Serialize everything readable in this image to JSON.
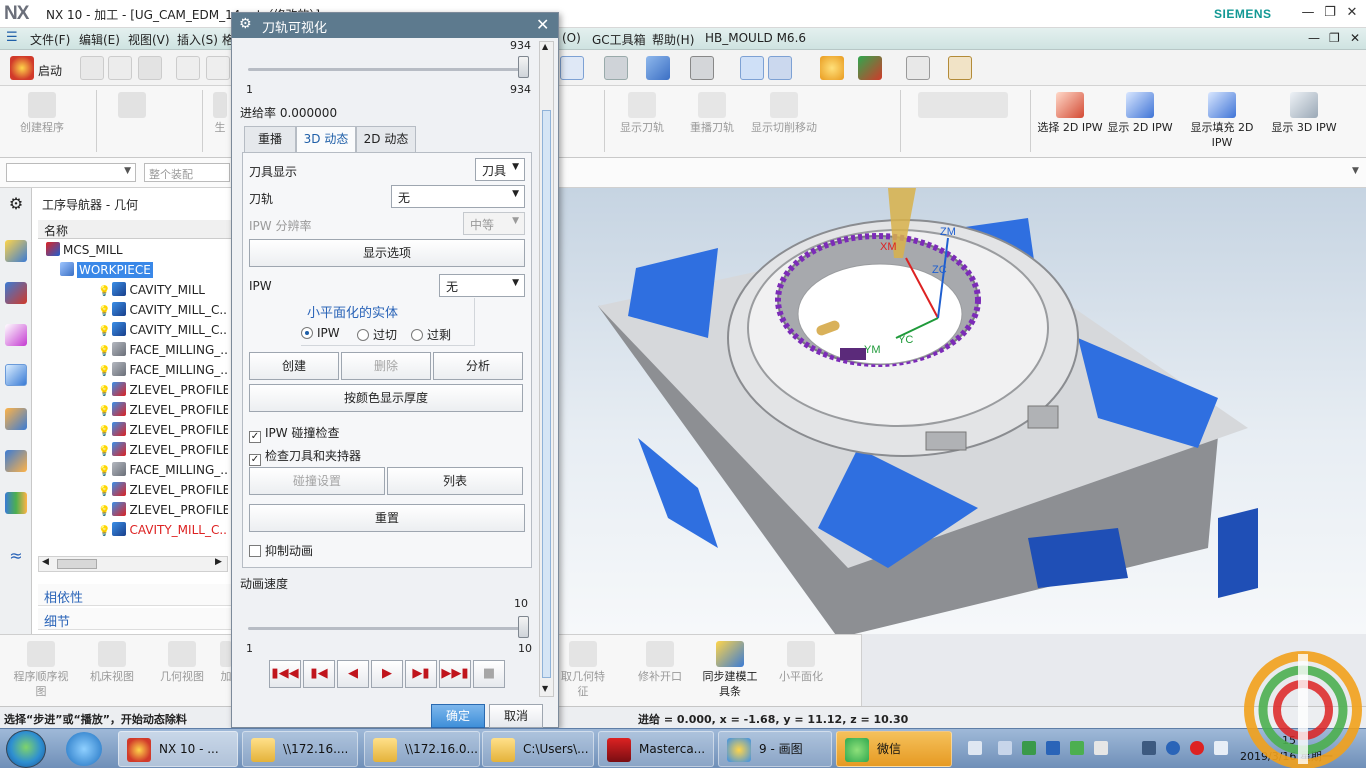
{
  "app": {
    "logo": "NX",
    "title": "NX 10 - 加工 - [UG_CAM_EDM_14.prt（修改的）]",
    "brand": "SIEMENS",
    "window_controls": [
      "minimize",
      "restore",
      "close"
    ]
  },
  "menubar": {
    "items": [
      "文件(F)",
      "编辑(E)",
      "视图(V)",
      "插入(S)",
      "格",
      "(O)",
      "GC工具箱",
      "帮助(H)",
      "HB_MOULD M6.6"
    ]
  },
  "toolbar": {
    "start_label": "启动"
  },
  "ribbon": {
    "left_groups": [
      {
        "label": "创建程序"
      },
      {
        "label": ""
      },
      {
        "label": "生"
      }
    ],
    "right_groups": [
      {
        "label": "显示刀轨"
      },
      {
        "label": "重播刀轨"
      },
      {
        "label": "显示切削移动"
      }
    ],
    "ipw_buttons": [
      {
        "label": "选择 2D IPW"
      },
      {
        "label": "显示 2D IPW"
      },
      {
        "label": "显示填充 2D IPW"
      },
      {
        "label": "显示 3D IPW"
      }
    ]
  },
  "selection_bar": {
    "filter_value": "",
    "assembly_placeholder": "整个装配"
  },
  "navigator": {
    "title": "工序导航器 - 几何",
    "column_header": "名称",
    "rows": [
      {
        "label": "MCS_MILL",
        "icon": "mcs-icon",
        "state": "normal"
      },
      {
        "label": "WORKPIECE",
        "icon": "workpiece-icon",
        "state": "selected"
      },
      {
        "label": "CAVITY_MILL",
        "icon": "cavity-mill-icon",
        "state": "normal"
      },
      {
        "label": "CAVITY_MILL_C...",
        "icon": "cavity-mill-icon",
        "state": "normal"
      },
      {
        "label": "CAVITY_MILL_C...",
        "icon": "cavity-mill-icon",
        "state": "normal"
      },
      {
        "label": "FACE_MILLING_...",
        "icon": "face-milling-icon",
        "state": "normal"
      },
      {
        "label": "FACE_MILLING_...",
        "icon": "face-milling-icon",
        "state": "normal"
      },
      {
        "label": "ZLEVEL_PROFILE",
        "icon": "zlevel-icon",
        "state": "normal"
      },
      {
        "label": "ZLEVEL_PROFILE",
        "icon": "zlevel-icon",
        "state": "normal"
      },
      {
        "label": "ZLEVEL_PROFILE",
        "icon": "zlevel-icon",
        "state": "normal"
      },
      {
        "label": "ZLEVEL_PROFILE",
        "icon": "zlevel-icon",
        "state": "normal"
      },
      {
        "label": "FACE_MILLING_...",
        "icon": "face-milling-icon",
        "state": "normal"
      },
      {
        "label": "ZLEVEL_PROFILE",
        "icon": "zlevel-icon",
        "state": "normal"
      },
      {
        "label": "ZLEVEL_PROFILE",
        "icon": "zlevel-icon",
        "state": "normal"
      },
      {
        "label": "CAVITY_MILL_C...",
        "icon": "cavity-mill-icon",
        "state": "error"
      }
    ],
    "panels": [
      "相依性",
      "细节"
    ]
  },
  "bottom_ribbon": {
    "left": [
      "程序顺序视图",
      "机床视图",
      "几何视图",
      "加"
    ],
    "right": [
      "取几何特征",
      "修补开口",
      "同步建模工具条",
      "小平面化"
    ]
  },
  "dialog": {
    "title": "刀轨可视化",
    "top_slider": {
      "max_label": "934",
      "min_label": "1",
      "value_label": "934",
      "value": 934,
      "min": 1,
      "max": 934
    },
    "feed_rate_label": "进给率 0.000000",
    "tabs": [
      {
        "label": "重播",
        "active": false
      },
      {
        "label": "3D 动态",
        "active": true
      },
      {
        "label": "2D 动态",
        "active": false
      }
    ],
    "tool_display_label": "刀具显示",
    "tool_display_value": "刀具",
    "toolpath_label": "刀轨",
    "toolpath_value": "无",
    "ipw_resolution_label": "IPW 分辨率",
    "ipw_resolution_value": "中等",
    "display_options_button": "显示选项",
    "ipw_label": "IPW",
    "ipw_value": "无",
    "facet_group_title": "小平面化的实体",
    "facet_options": [
      {
        "label": "IPW",
        "selected": true
      },
      {
        "label": "过切",
        "selected": false
      },
      {
        "label": "过剩",
        "selected": false
      }
    ],
    "create_button": "创建",
    "delete_button": "删除",
    "analyze_button": "分析",
    "color_thickness_button": "按颜色显示厚度",
    "ipw_collision_check": {
      "label": "IPW 碰撞检查",
      "checked": true
    },
    "check_tool_holder": {
      "label": "检查刀具和夹持器",
      "checked": true
    },
    "collision_settings_button": "碰撞设置",
    "list_button": "列表",
    "reset_button": "重置",
    "suppress_animation": {
      "label": "抑制动画",
      "checked": false
    },
    "anim_speed_label": "动画速度",
    "speed_slider": {
      "max_label": "10",
      "min_label": "1",
      "value_label": "10",
      "value": 10,
      "min": 1,
      "max": 10
    },
    "playback_buttons": [
      "rewind-to-start",
      "step-back",
      "play-reverse",
      "play-forward",
      "step-forward",
      "fast-forward-to-end",
      "stop"
    ],
    "ok_button": "确定",
    "cancel_button": "取消"
  },
  "statusbar": {
    "prompt": "选择“步进”或“播放”，开始动态除料",
    "coords": "进给 = 0.000, x = -1.68, y = 11.12, z = 10.30"
  },
  "viewport": {
    "axis_labels": [
      "ZM",
      "XM",
      "ZC",
      "YM",
      "YC"
    ]
  },
  "taskbar": {
    "tasks": [
      {
        "label": "NX 10 - ...",
        "icon": "nx-icon",
        "active": true
      },
      {
        "label": "\\\\172.16....",
        "icon": "folder-icon",
        "active": false
      },
      {
        "label": "\\\\172.16.0...",
        "icon": "folder-icon",
        "active": false
      },
      {
        "label": "C:\\Users\\...",
        "icon": "folder-icon",
        "active": false
      },
      {
        "label": "Masterca...",
        "icon": "mastercam-icon",
        "active": false
      },
      {
        "label": "9 - 画图",
        "icon": "paint-icon",
        "active": false
      },
      {
        "label": "微信",
        "icon": "wechat-icon",
        "active": false
      }
    ],
    "clock_time": "15",
    "clock_date": "2019/3/16 星期一"
  },
  "colors": {
    "dialog_title": "#5d7a8e",
    "menubar": "#d7e9e7",
    "selection_blue": "#3a88e8",
    "ipw_blue": "#2f6fe0",
    "siemens": "#129894",
    "playback_red": "#c0141c"
  }
}
